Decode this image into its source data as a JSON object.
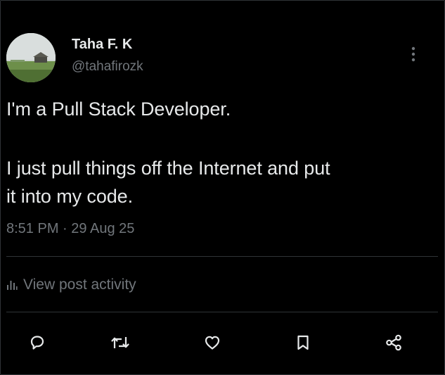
{
  "author": {
    "display_name": "Taha F. K",
    "handle": "@tahafirozk",
    "avatar_icon": "profile-landscape-photo"
  },
  "post": {
    "lines": [
      "I'm a Pull Stack Developer.",
      "I just pull things off the Internet and put",
      "it into my code."
    ],
    "time": "8:51 PM",
    "separator": "·",
    "date": "29 Aug 25"
  },
  "activity": {
    "icon": "bar-chart-icon",
    "label": "View post activity"
  },
  "actions": [
    {
      "name": "reply",
      "icon": "speech-bubble-icon"
    },
    {
      "name": "repost",
      "icon": "repost-arrows-icon"
    },
    {
      "name": "like",
      "icon": "heart-icon"
    },
    {
      "name": "bookmark",
      "icon": "bookmark-icon"
    },
    {
      "name": "share",
      "icon": "share-nodes-icon"
    }
  ],
  "colors": {
    "background": "#000000",
    "text_primary": "#e7e9ea",
    "text_secondary": "#71767b",
    "divider": "#2f3336"
  }
}
